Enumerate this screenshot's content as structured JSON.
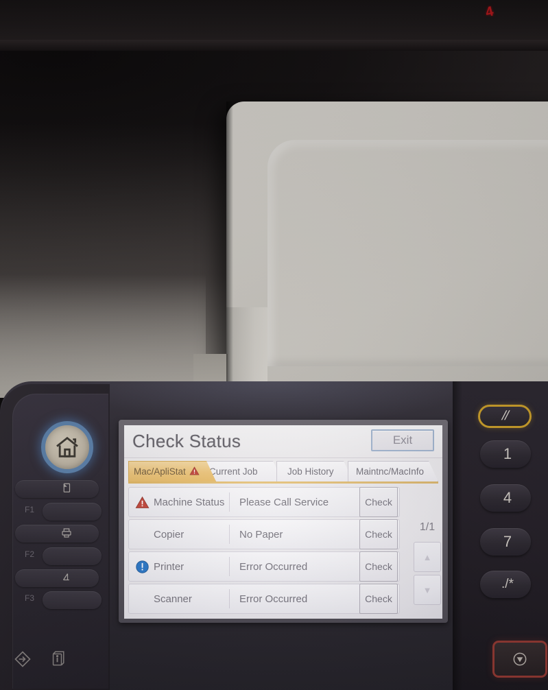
{
  "scene": {
    "description": "Photo of a multifunction printer control panel showing the Check Status screen",
    "red_mark": "4"
  },
  "lcd": {
    "title": "Check Status",
    "exit_label": "Exit",
    "tabs": [
      {
        "label": "Mac/ApliStat",
        "active": true,
        "warning": true
      },
      {
        "label": "Current Job",
        "active": false,
        "warning": false
      },
      {
        "label": "Job History",
        "active": false,
        "warning": false
      },
      {
        "label": "Maintnc/MacInfo",
        "active": false,
        "warning": false
      }
    ],
    "rows": [
      {
        "icon": "warning-triangle-icon",
        "name": "Machine Status",
        "message": "Please Call Service",
        "action": "Check"
      },
      {
        "icon": "none",
        "name": "Copier",
        "message": "No Paper",
        "action": "Check"
      },
      {
        "icon": "info-circle-icon",
        "name": "Printer",
        "message": "Error Occurred",
        "action": "Check"
      },
      {
        "icon": "none",
        "name": "Scanner",
        "message": "Error Occurred",
        "action": "Check"
      }
    ],
    "pager": {
      "indicator": "1/1",
      "up_label": "▲",
      "down_label": "▼"
    }
  },
  "panel": {
    "left": {
      "home_icon": "home-icon",
      "function_keys": [
        {
          "label": "F1",
          "icon": "copy-icon"
        },
        {
          "label": "F2",
          "icon": "printer-icon"
        },
        {
          "label": "F3",
          "icon": "scanner-icon"
        }
      ],
      "bottom_icons": [
        {
          "icon": "login-logout-icon"
        },
        {
          "icon": "counter-info-icon"
        }
      ]
    },
    "keypad": {
      "clear_label": "//",
      "keys": [
        "1",
        "4",
        "7",
        "./*"
      ],
      "stop_icon": "stop-icon"
    }
  },
  "colors": {
    "tab_active": "#e8b95f",
    "warning_red": "#c0392b",
    "info_blue": "#1c6fc4",
    "exit_border": "#9fb4cf",
    "home_ring": "#5b7fa8",
    "stop_border": "#8d3630",
    "clear_border": "#c79c29"
  }
}
